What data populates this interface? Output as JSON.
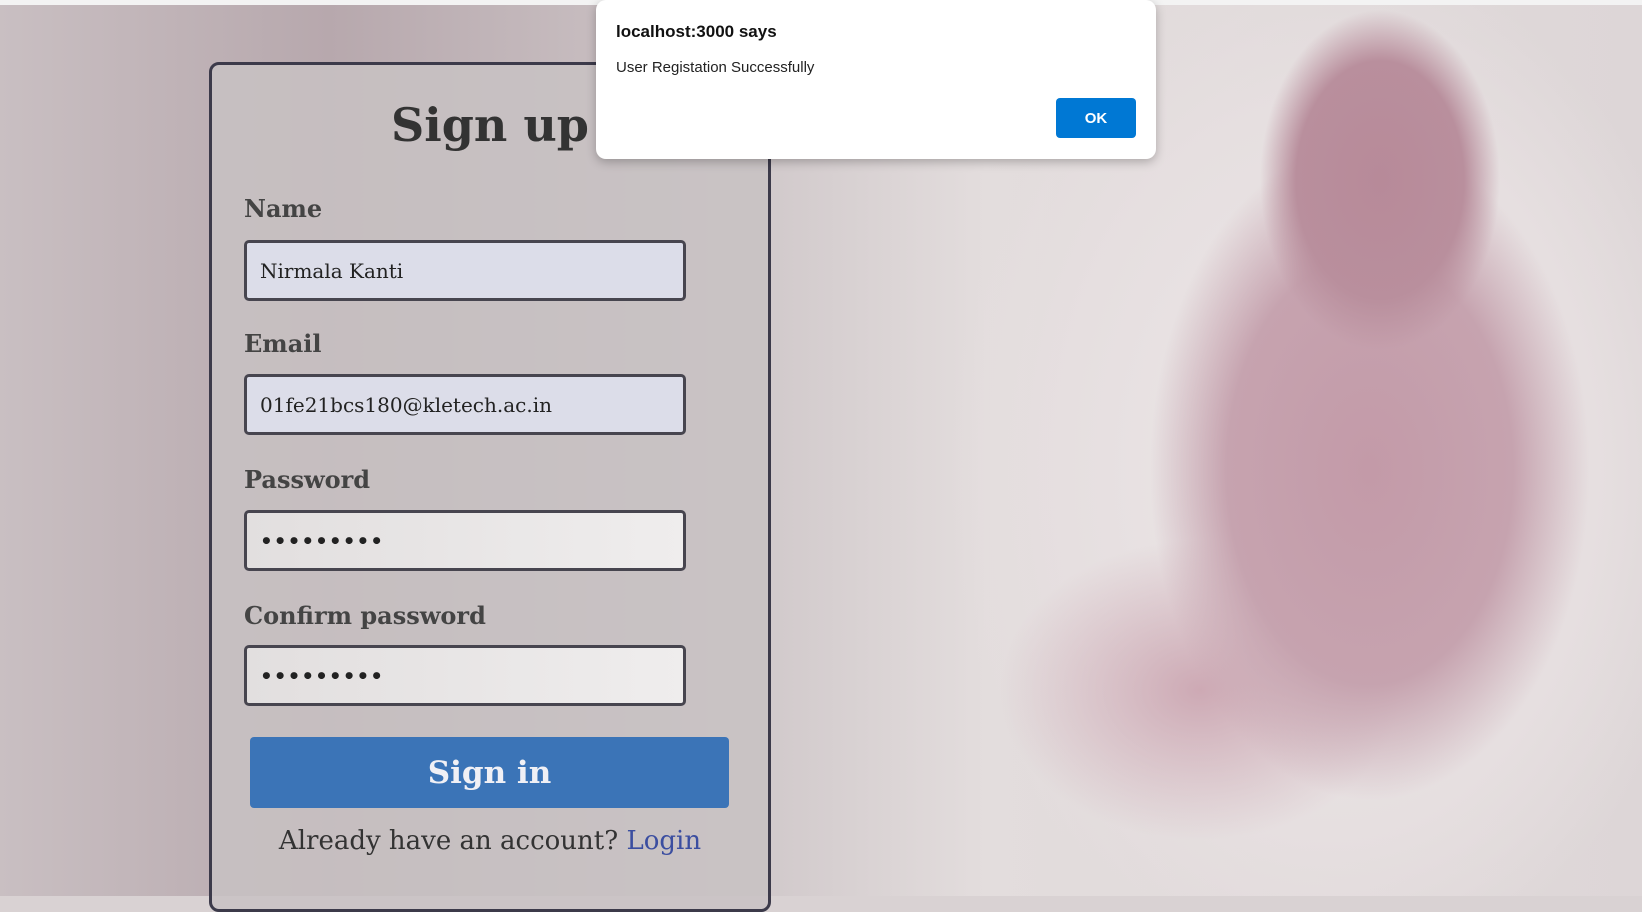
{
  "form": {
    "title": "Sign up",
    "fields": [
      {
        "label": "Name",
        "value": "Nirmala Kanti"
      },
      {
        "label": "Email",
        "value": "01fe21bcs180@kletech.ac.in"
      },
      {
        "label": "Password",
        "value": "•••••••••"
      },
      {
        "label": "Confirm password",
        "value": "•••••••••"
      }
    ],
    "submit_label": "Sign in",
    "footer_text": "Already have an account?",
    "login_link": "Login"
  },
  "dialog": {
    "title": "localhost:3000 says",
    "message": "User Registation Successfully",
    "ok_label": "OK"
  }
}
